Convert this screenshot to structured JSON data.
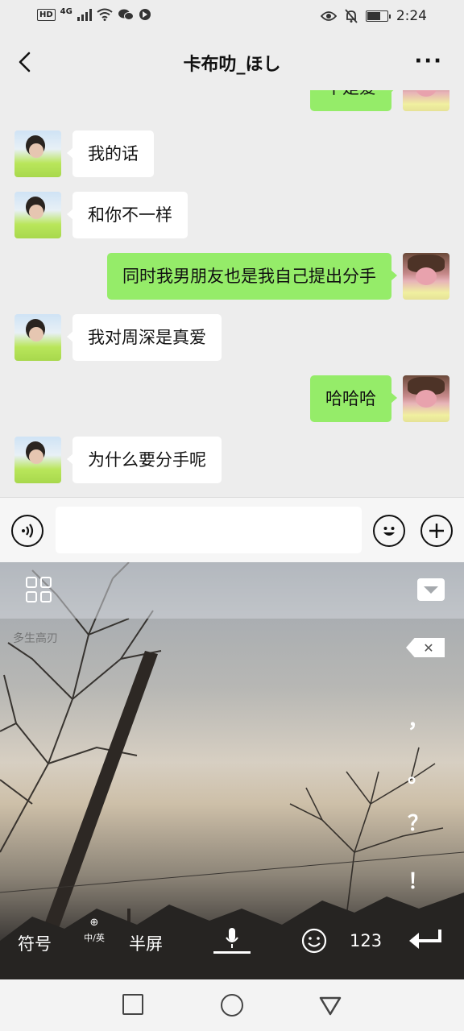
{
  "status_bar": {
    "network_badge": "HD",
    "network_type": "4G",
    "time": "2:24",
    "battery_level": 0.64
  },
  "chat": {
    "title": "卡布叻_ほし"
  },
  "messages": [
    {
      "side": "right",
      "text": "不是爱"
    },
    {
      "side": "left",
      "text": "我的话"
    },
    {
      "side": "left",
      "text": "和你不一样"
    },
    {
      "side": "right",
      "text": "同时我男朋友也是我自己提出分手"
    },
    {
      "side": "left",
      "text": "我对周深是真爱"
    },
    {
      "side": "right",
      "text": "哈哈哈"
    },
    {
      "side": "left",
      "text": "为什么要分手呢"
    }
  ],
  "input": {
    "value": "",
    "placeholder": ""
  },
  "keyboard": {
    "watermark": "多生高刃",
    "punctuation": [
      "，",
      "。",
      "？",
      "！"
    ],
    "symbols_label": "符号",
    "lang_switch_label": "中/英",
    "half_width_label": "半屏",
    "numbers_label": "123"
  },
  "colors": {
    "sent_bubble": "#95ec69",
    "received_bubble": "#ffffff",
    "background": "#ededed"
  }
}
